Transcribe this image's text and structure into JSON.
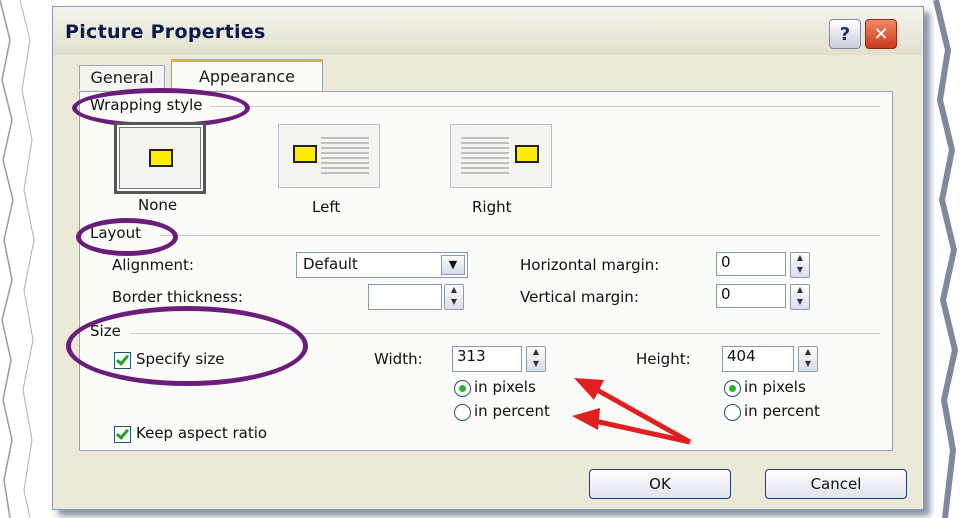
{
  "dialog": {
    "title": "Picture Properties",
    "help_label": "?",
    "close_label": "✕"
  },
  "tabs": [
    {
      "label": "General",
      "selected": false
    },
    {
      "label": "Appearance",
      "selected": true
    }
  ],
  "wrapping": {
    "heading": "Wrapping style",
    "options": [
      {
        "label": "None",
        "selected": true
      },
      {
        "label": "Left",
        "selected": false
      },
      {
        "label": "Right",
        "selected": false
      }
    ]
  },
  "layout": {
    "heading": "Layout",
    "alignment_label": "Alignment:",
    "alignment_value": "Default",
    "border_label": "Border thickness:",
    "border_value": "",
    "hmargin_label": "Horizontal margin:",
    "hmargin_value": "0",
    "vmargin_label": "Vertical margin:",
    "vmargin_value": "0"
  },
  "size": {
    "heading": "Size",
    "specify_label": "Specify size",
    "specify_checked": true,
    "width_label": "Width:",
    "width_value": "313",
    "height_label": "Height:",
    "height_value": "404",
    "in_pixels": "in pixels",
    "in_percent": "in percent",
    "keep_aspect_label": "Keep aspect ratio",
    "keep_aspect_checked": true
  },
  "buttons": {
    "ok": "OK",
    "cancel": "Cancel"
  },
  "colors": {
    "annotation_oval": "#6a1d7a",
    "annotation_arrow": "#e02020",
    "dialog_face": "#ece9d8",
    "swatch": "#ffee00"
  }
}
